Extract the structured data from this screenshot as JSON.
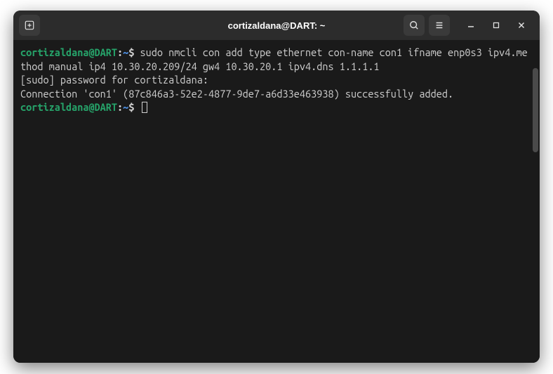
{
  "window": {
    "title": "cortizaldana@DART: ~"
  },
  "terminal": {
    "prompt1": {
      "user_host": "cortizaldana@DART",
      "sep1": ":",
      "path": "~",
      "sep2": "$",
      "command": " sudo nmcli con add type ethernet con-name con1 ifname enp0s3 ipv4.method manual ip4 10.30.20.209/24 gw4 10.30.20.1 ipv4.dns 1.1.1.1"
    },
    "line2": "[sudo] password for cortizaldana:",
    "line3": "Connection 'con1' (87c846a3-52e2-4877-9de7-a6d33e463938) successfully added.",
    "prompt2": {
      "user_host": "cortizaldana@DART",
      "sep1": ":",
      "path": "~",
      "sep2": "$"
    }
  }
}
